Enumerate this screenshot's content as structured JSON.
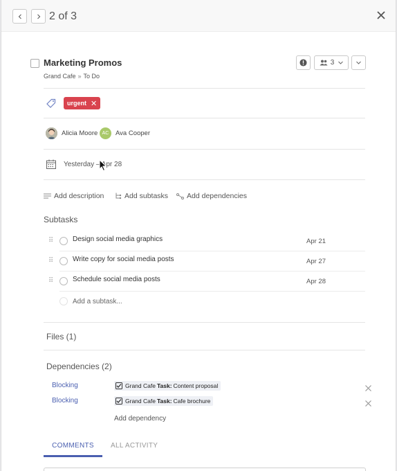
{
  "pager": {
    "text": "2 of 3"
  },
  "task": {
    "title": "Marketing Promos",
    "breadcrumb": {
      "project": "Grand Cafe",
      "separator": "»",
      "list": "To Do"
    },
    "assignee_count": "3"
  },
  "tags": [
    {
      "label": "urgent",
      "color": "#d9434e"
    }
  ],
  "assignees": [
    {
      "name": "Alicia Moore",
      "initials": "",
      "avatar_color": "#8b8f83"
    },
    {
      "name": "Ava Cooper",
      "initials": "AC",
      "avatar_color": "#a9c96a"
    }
  ],
  "date": {
    "text": "Yesterday – Apr 28"
  },
  "actions": {
    "description": "Add description",
    "subtasks": "Add subtasks",
    "dependencies": "Add dependencies"
  },
  "subtasks": {
    "heading": "Subtasks",
    "items": [
      {
        "name": "Design social media graphics",
        "due": "Apr 21"
      },
      {
        "name": "Write copy for social media posts",
        "due": "Apr 27"
      },
      {
        "name": "Schedule social media posts",
        "due": "Apr 28"
      }
    ],
    "add_placeholder": "Add a subtask..."
  },
  "files": {
    "heading": "Files (1)"
  },
  "dependencies": {
    "heading": "Dependencies (2)",
    "items": [
      {
        "kind": "Blocking",
        "project": "Grand Cafe",
        "label": "Task:",
        "name": "Content proposal"
      },
      {
        "kind": "Blocking",
        "project": "Grand Cafe",
        "label": "Task:",
        "name": "Cafe brochure"
      }
    ],
    "add_label": "Add dependency"
  },
  "tabs": [
    {
      "label": "COMMENTS",
      "active": true
    },
    {
      "label": "ALL ACTIVITY",
      "active": false
    }
  ],
  "colors": {
    "accent": "#4a5fb0",
    "tag": "#d9434e"
  },
  "icons": [
    "chevron-left-icon",
    "chevron-right-icon",
    "close-icon",
    "alert-icon",
    "people-icon",
    "chevron-down-icon",
    "tag-icon",
    "calendar-icon",
    "description-icon",
    "subtask-icon",
    "dependency-icon",
    "drag-handle-icon",
    "checkbox-icon"
  ]
}
